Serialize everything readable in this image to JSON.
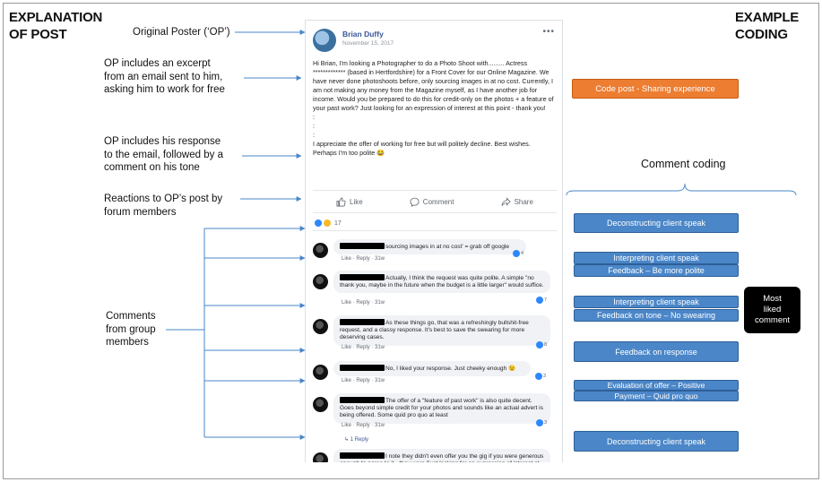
{
  "headings": {
    "left_line1": "EXPLANATION",
    "left_line2": "OF POST",
    "right_line1": "EXAMPLE",
    "right_line2": "CODING",
    "comment_coding": "Comment coding"
  },
  "annotations": {
    "op": "Original Poster (‘OP’)",
    "excerpt_1": "OP includes an excerpt",
    "excerpt_2": "from an email sent to him,",
    "excerpt_3": "asking him to work for free",
    "response_1": "OP includes his response",
    "response_2": "to the email, followed by a",
    "response_3": "comment on his tone",
    "reactions_1": "Reactions to OP’s post by",
    "reactions_2": "forum members",
    "comments_1": "Comments",
    "comments_2": "from group",
    "comments_3": "members"
  },
  "post": {
    "author": "Brian Duffy",
    "date": "November 15, 2017",
    "menu": "•••",
    "body": "Hi Brian, I'm looking a Photographer to do a Photo Shoot with......... Actress ************* (based in Hertfordshire) for a Front Cover for our Online Magazine. We have never done photoshoots before, only sourcing images in at no cost. Currently, I am not making any money from the Magazine myself, as I have another job for income. Would you be prepared to do this for credit-only on the photos + a feature of your past work? Just looking for an expression of interest at this point - thank you!\n:\n:\n:\nI appreciate the offer of working for free but will politely decline. Best wishes.\nPerhaps I'm too polite 😂",
    "actions": {
      "like": "Like",
      "comment": "Comment",
      "share": "Share"
    },
    "reaction_count": "17"
  },
  "comments": [
    {
      "text": "sourcing images in at no cost' = grab off google",
      "meta": "Like · Reply · 31w",
      "likes": "4"
    },
    {
      "text": "Actually, I think the request was quite polite. A simple \"no thank you, maybe in the future when the budget is a little larger\" would suffice.",
      "meta": "Like · Reply · 31w",
      "likes": "7"
    },
    {
      "text": "As these things go, that was a refreshingly bullshit-free request, and a classy response. It's best to save the swearing for more deserving cases.",
      "meta": "Like · Reply · 31w",
      "likes": "8"
    },
    {
      "text": "No, I liked your response. Just cheeky enough 😉",
      "meta": "Like · Reply · 31w",
      "likes": "3"
    },
    {
      "text": "The offer of a \"feature of past work\" is also quite decent. Goes beyond simple credit for your photos and sounds like an actual advert is being offered. Some quid pro quo at least",
      "meta": "Like · Reply · 31w",
      "likes": "3",
      "replies": "↳ 1 Reply"
    },
    {
      "text": "I note they didn't even offer you the gig if you were generous enough to agree to it - they were \"just looking for an expression of interest at this point.\" It almost sounds like they were"
    }
  ],
  "codes": {
    "post": "Code post - Sharing experience",
    "c1": "Deconstructing client speak",
    "c2a": "Interpreting client speak",
    "c2b": "Feedback – Be more polite",
    "c3a": "Interpreting client speak",
    "c3b": "Feedback on tone – No swearing",
    "most_liked_1": "Most",
    "most_liked_2": "liked",
    "most_liked_3": "comment",
    "c4": "Feedback on response",
    "c5a": "Evaluation of offer – Positive",
    "c5b": "Payment – Quid pro quo",
    "c6": "Deconstructing client speak"
  },
  "colors": {
    "code_blue": "#4a86c8",
    "code_orange": "#ed7d31",
    "arrow_blue": "#4a86c8",
    "facebook_blue": "#385898"
  }
}
